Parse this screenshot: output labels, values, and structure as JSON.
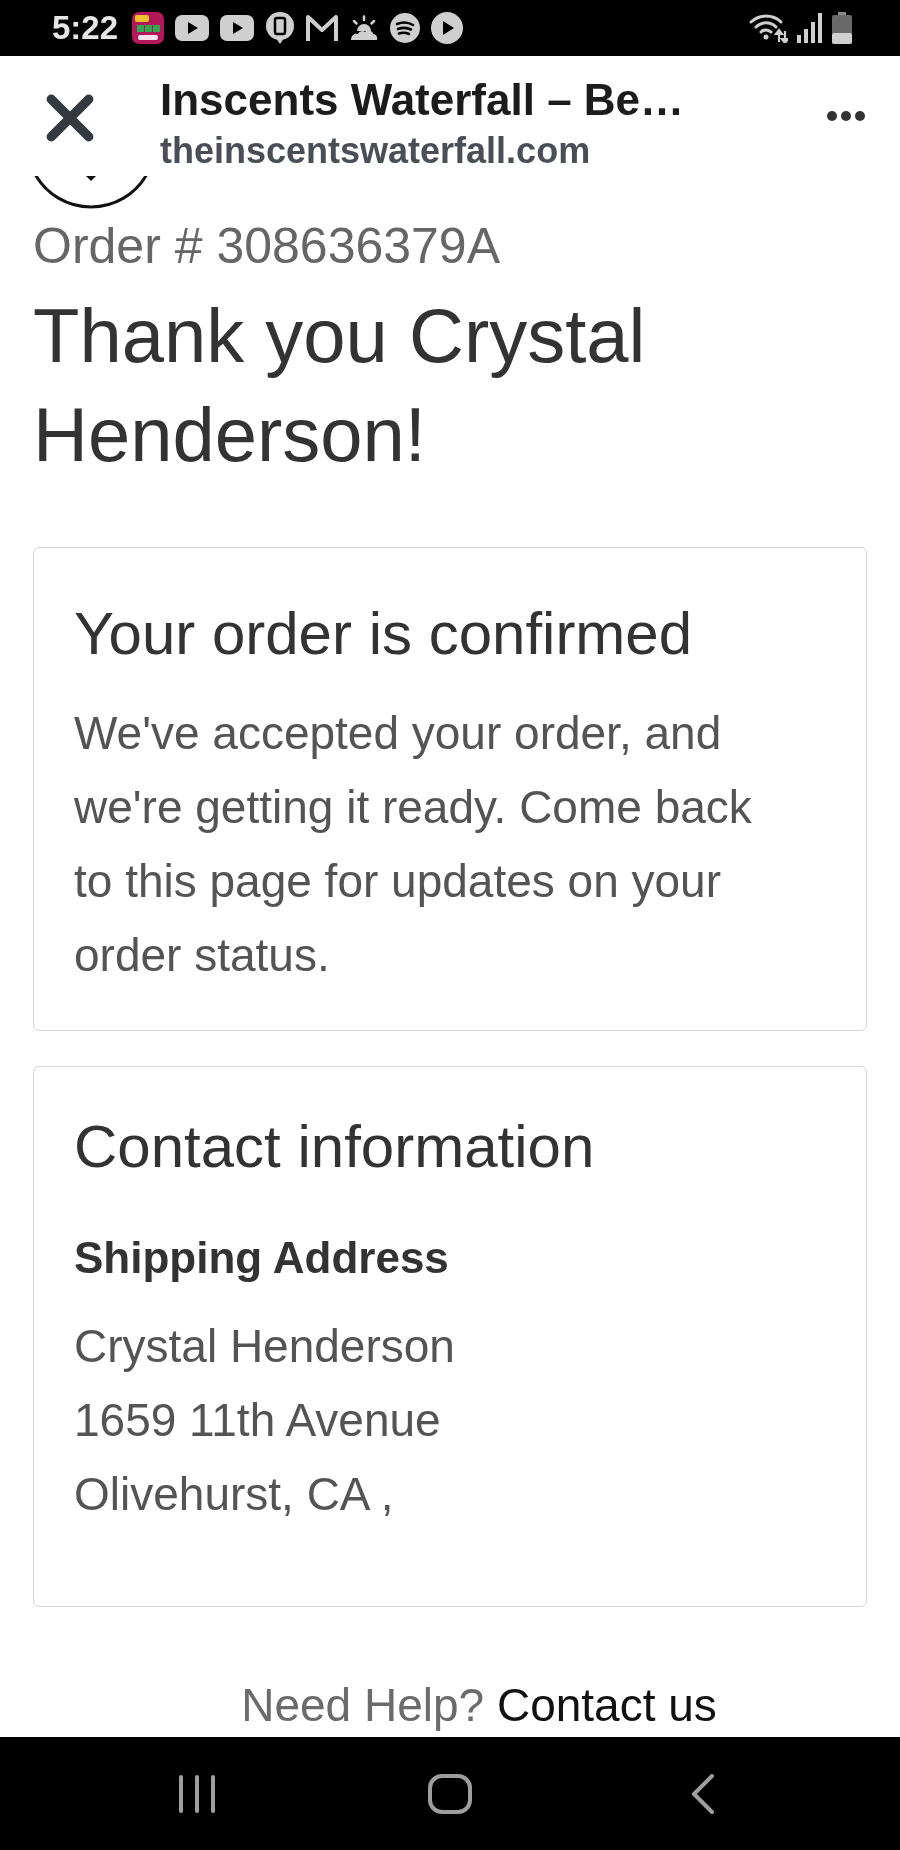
{
  "status_bar": {
    "time": "5:22"
  },
  "header": {
    "title": "Inscents Waterfall – Be…",
    "domain": "theinscentswaterfall.com"
  },
  "order_number": "Order # 308636379A",
  "heading": "Thank you Crystal Henderson!",
  "confirmation_card": {
    "title": "Your order is confirmed",
    "message": "We've accepted your order, and we're getting it ready. Come back to this page for updates on your order status."
  },
  "contact_card": {
    "title": "Contact information",
    "section_title": "Shipping Address",
    "address_lines": [
      "Crystal Henderson",
      "1659 11th Avenue",
      "Olivehurst, CA ,"
    ]
  },
  "help": {
    "text": "Need Help?",
    "link": "Contact us"
  }
}
